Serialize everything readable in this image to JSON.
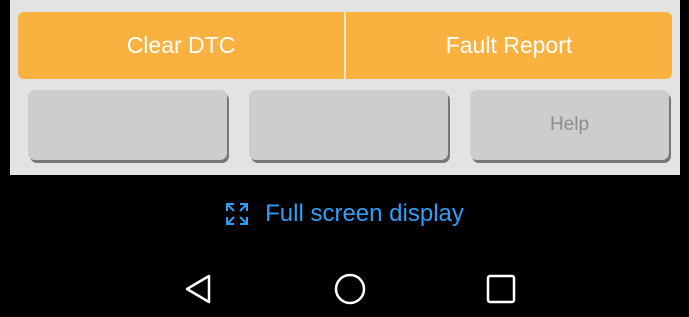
{
  "actions": {
    "clear_dtc": "Clear DTC",
    "fault_report": "Fault Report"
  },
  "buttons": [
    "",
    "",
    "Help"
  ],
  "fullscreen": {
    "label": "Full screen display",
    "icon": "expand-icon"
  },
  "nav": {
    "back": "back-triangle-icon",
    "home": "home-circle-icon",
    "recents": "recents-square-icon"
  },
  "colors": {
    "accent": "#f9b13f",
    "link": "#2f9ef4",
    "button": "#cdcdcd",
    "background": "#e3e3e3"
  }
}
